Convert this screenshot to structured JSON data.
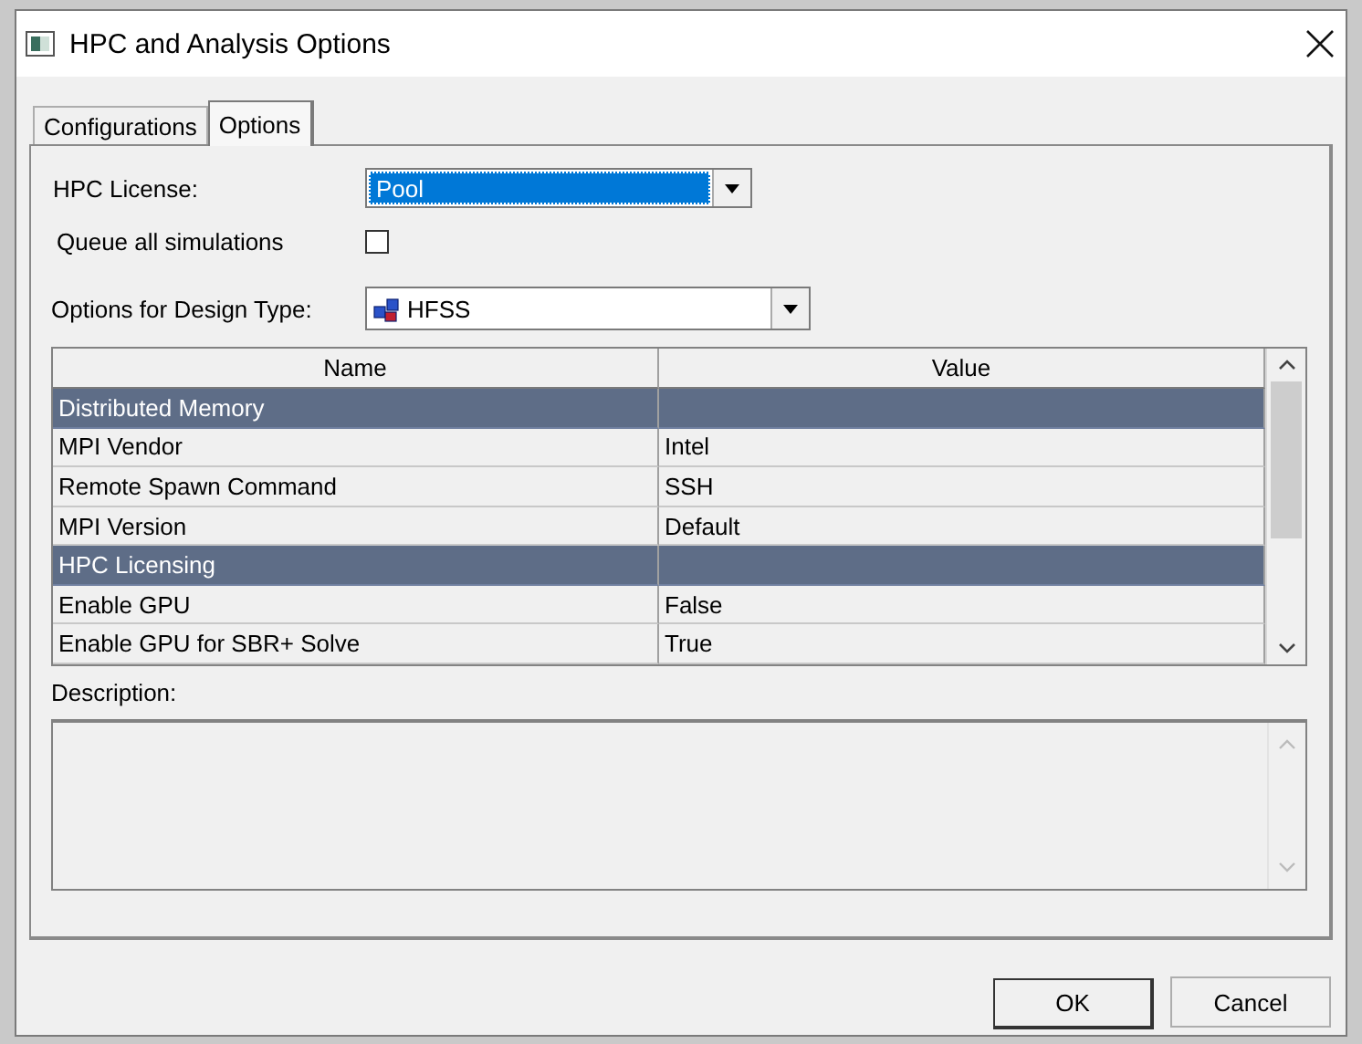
{
  "window": {
    "title": "HPC and Analysis Options"
  },
  "tabs": [
    {
      "label": "Configurations",
      "selected": false
    },
    {
      "label": "Options",
      "selected": true
    }
  ],
  "hpc_license": {
    "label": "HPC License:",
    "value": "Pool",
    "highlighted": true
  },
  "queue_all": {
    "label": "Queue all simulations",
    "checked": false
  },
  "design_type": {
    "label": "Options for Design Type:",
    "value": "HFSS"
  },
  "table": {
    "columns": [
      "Name",
      "Value"
    ],
    "rows": [
      {
        "kind": "group",
        "name": "Distributed Memory"
      },
      {
        "kind": "property",
        "name": "MPI Vendor",
        "value": "Intel"
      },
      {
        "kind": "property",
        "name": "Remote Spawn Command",
        "value": "SSH"
      },
      {
        "kind": "property",
        "name": "MPI Version",
        "value": "Default"
      },
      {
        "kind": "group",
        "name": "HPC Licensing"
      },
      {
        "kind": "property",
        "name": "Enable GPU",
        "value": "False"
      },
      {
        "kind": "property",
        "name": "Enable GPU for SBR+ Solve",
        "value": "True"
      }
    ]
  },
  "description": {
    "label": "Description:"
  },
  "buttons": [
    {
      "label": "OK",
      "default": true
    },
    {
      "label": "Cancel",
      "default": false
    }
  ]
}
